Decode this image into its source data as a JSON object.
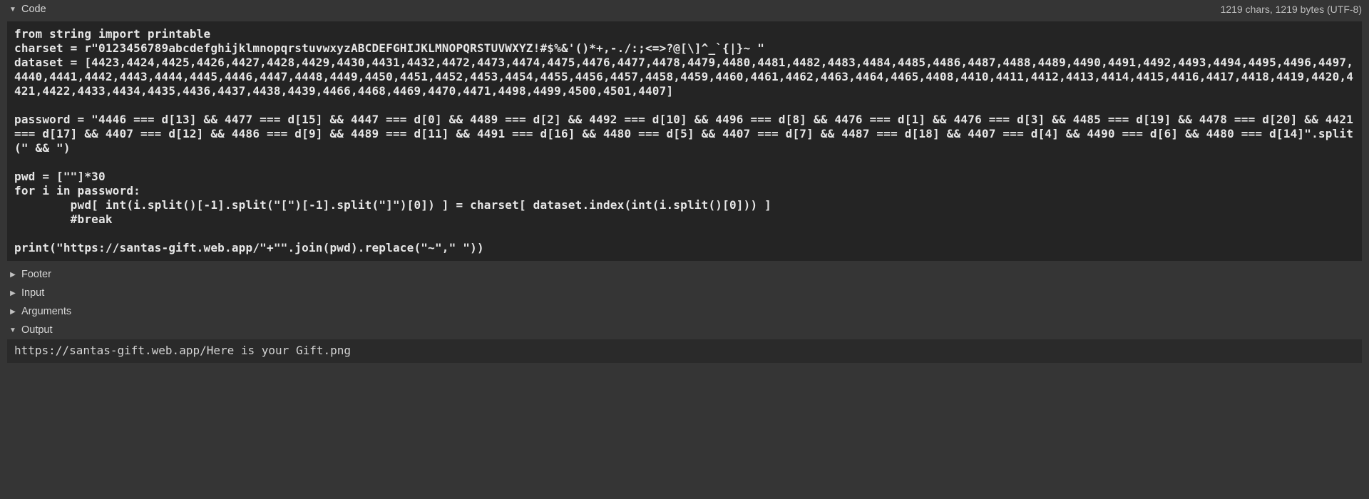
{
  "sections": {
    "code": {
      "label": "Code",
      "info": "1219 chars, 1219 bytes (UTF-8)",
      "expanded": true,
      "content": "from string import printable\ncharset = r\"0123456789abcdefghijklmnopqrstuvwxyzABCDEFGHIJKLMNOPQRSTUVWXYZ!#$%&'()*+,-./:;<=>?@[\\]^_`{|}~ \"\ndataset = [4423,4424,4425,4426,4427,4428,4429,4430,4431,4432,4472,4473,4474,4475,4476,4477,4478,4479,4480,4481,4482,4483,4484,4485,4486,4487,4488,4489,4490,4491,4492,4493,4494,4495,4496,4497,4440,4441,4442,4443,4444,4445,4446,4447,4448,4449,4450,4451,4452,4453,4454,4455,4456,4457,4458,4459,4460,4461,4462,4463,4464,4465,4408,4410,4411,4412,4413,4414,4415,4416,4417,4418,4419,4420,4421,4422,4433,4434,4435,4436,4437,4438,4439,4466,4468,4469,4470,4471,4498,4499,4500,4501,4407]\n\npassword = \"4446 === d[13] && 4477 === d[15] && 4447 === d[0] && 4489 === d[2] && 4492 === d[10] && 4496 === d[8] && 4476 === d[1] && 4476 === d[3] && 4485 === d[19] && 4478 === d[20] && 4421 === d[17] && 4407 === d[12] && 4486 === d[9] && 4489 === d[11] && 4491 === d[16] && 4480 === d[5] && 4407 === d[7] && 4487 === d[18] && 4407 === d[4] && 4490 === d[6] && 4480 === d[14]\".split(\" && \")\n\npwd = [\"\"]*30\nfor i in password:\n        pwd[ int(i.split()[-1].split(\"[\")[-1].split(\"]\")[0]) ] = charset[ dataset.index(int(i.split()[0])) ]\n        #break\n\nprint(\"https://santas-gift.web.app/\"+\"\".join(pwd).replace(\"~\",\" \"))"
    },
    "footer": {
      "label": "Footer",
      "expanded": false
    },
    "input": {
      "label": "Input",
      "expanded": false
    },
    "arguments": {
      "label": "Arguments",
      "expanded": false
    },
    "output": {
      "label": "Output",
      "expanded": true,
      "content": "https://santas-gift.web.app/Here is your Gift.png"
    }
  },
  "glyphs": {
    "expanded": "▼",
    "collapsed": "▶"
  }
}
